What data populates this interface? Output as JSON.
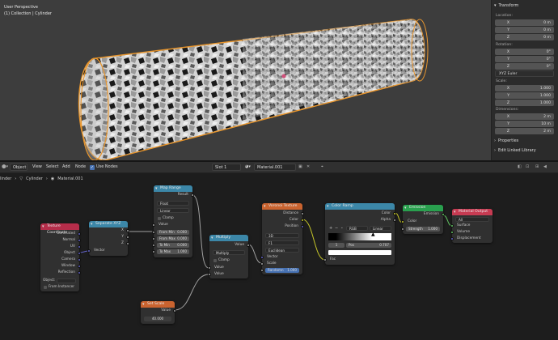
{
  "viewport": {
    "mode": "User Perspective",
    "collection": "(1) Collection | Cylinder"
  },
  "npanel": {
    "transform_title": "Transform",
    "location_label": "Location:",
    "location": [
      {
        "k": "X",
        "v": "0 m"
      },
      {
        "k": "Y",
        "v": "0 m"
      },
      {
        "k": "Z",
        "v": "0 m"
      }
    ],
    "rotation_label": "Rotation:",
    "rotation": [
      {
        "k": "X",
        "v": "0°"
      },
      {
        "k": "Y",
        "v": "0°"
      },
      {
        "k": "Z",
        "v": "0°"
      }
    ],
    "rotation_mode": "XYZ Euler",
    "scale_label": "Scale:",
    "scale": [
      {
        "k": "X",
        "v": "1.000"
      },
      {
        "k": "Y",
        "v": "1.000"
      },
      {
        "k": "Z",
        "v": "1.000"
      }
    ],
    "dimensions_label": "Dimensions:",
    "dimensions": [
      {
        "k": "X",
        "v": "2 m"
      },
      {
        "k": "Y",
        "v": "10 m"
      },
      {
        "k": "Z",
        "v": "2 m"
      }
    ],
    "properties_title": "Properties",
    "linked_title": "Edit Linked Library"
  },
  "header": {
    "mode": "Object",
    "menus": [
      "View",
      "Select",
      "Add",
      "Node"
    ],
    "use_nodes": "Use Nodes",
    "slot": "Slot 1",
    "material": "Material.001"
  },
  "breadcrumb": {
    "object_fragment": "linder",
    "object": "Cylinder",
    "material": "Material.001"
  },
  "nodes": {
    "texcoord": {
      "title": "Texture Coordinate",
      "outputs": [
        "Generated",
        "Normal",
        "UV",
        "Object",
        "Camera",
        "Window",
        "Reflection"
      ],
      "object_label": "Object:",
      "from_instancer": "From Instancer"
    },
    "sepxyz": {
      "title": "Separate XYZ",
      "outputs": [
        "X",
        "Y",
        "Z"
      ],
      "input": "Vector"
    },
    "maprange": {
      "title": "Map Range",
      "output": "Result",
      "type": "Float",
      "interp": "Linear",
      "clamp": "Clamp",
      "value": "Value",
      "fields": [
        {
          "k": "From Min",
          "v": "0.000"
        },
        {
          "k": "From Max",
          "v": "0.000"
        },
        {
          "k": "To Min",
          "v": "0.000"
        },
        {
          "k": "To Max",
          "v": "1.000"
        }
      ]
    },
    "multiply": {
      "title": "Multiply",
      "output": "Value",
      "op": "Multiply",
      "clamp": "Clamp",
      "in1": "Value",
      "in2": "Value"
    },
    "setscale": {
      "title": "Set Scale",
      "output": "Value",
      "value": "40.000"
    },
    "voronoi": {
      "title": "Voronoi Texture",
      "outputs": [
        "Distance",
        "Color",
        "Position"
      ],
      "dim": "3D",
      "feature": "F1",
      "metric": "Euclidean",
      "vector": "Vector",
      "scale": "Scale",
      "random_k": "Randomn",
      "random_v": "1.000"
    },
    "ramp": {
      "title": "Color Ramp",
      "outputs": [
        "Color",
        "Alpha"
      ],
      "mode": "RGB",
      "interp": "Linear",
      "stop": "1",
      "pos_k": "Pos",
      "pos_v": "0.707",
      "fac": "Fac"
    },
    "emission": {
      "title": "Emission",
      "output": "Emission",
      "color": "Color",
      "strength_k": "Strength",
      "strength_v": "1.000"
    },
    "output": {
      "title": "Material Output",
      "target": "All",
      "inputs": [
        "Surface",
        "Volume",
        "Displacement"
      ]
    }
  },
  "colors": {
    "selected_outline": "#e8962e",
    "converter": "#3c87a8",
    "texture": "#c9632f",
    "shader": "#29a04e",
    "input": "#b52d4a",
    "output": "#c73b52"
  }
}
